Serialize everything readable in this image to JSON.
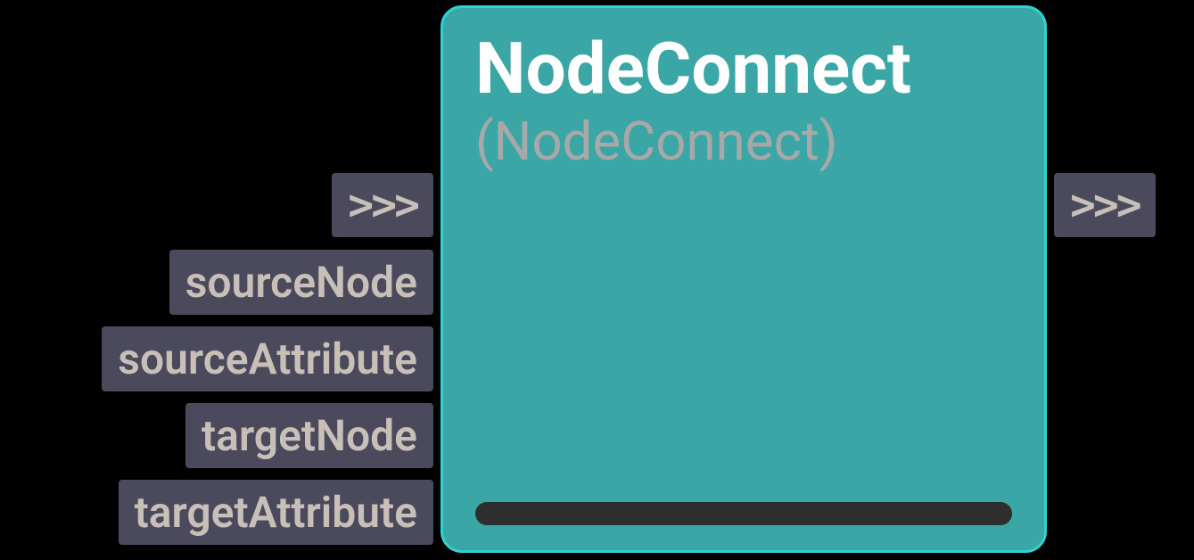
{
  "node": {
    "title": "NodeConnect",
    "subtitle": "(NodeConnect)"
  },
  "ports": {
    "inArrow": ">>>",
    "outArrow": ">>>",
    "inputs": [
      "sourceNode",
      "sourceAttribute",
      "targetNode",
      "targetAttribute"
    ]
  }
}
